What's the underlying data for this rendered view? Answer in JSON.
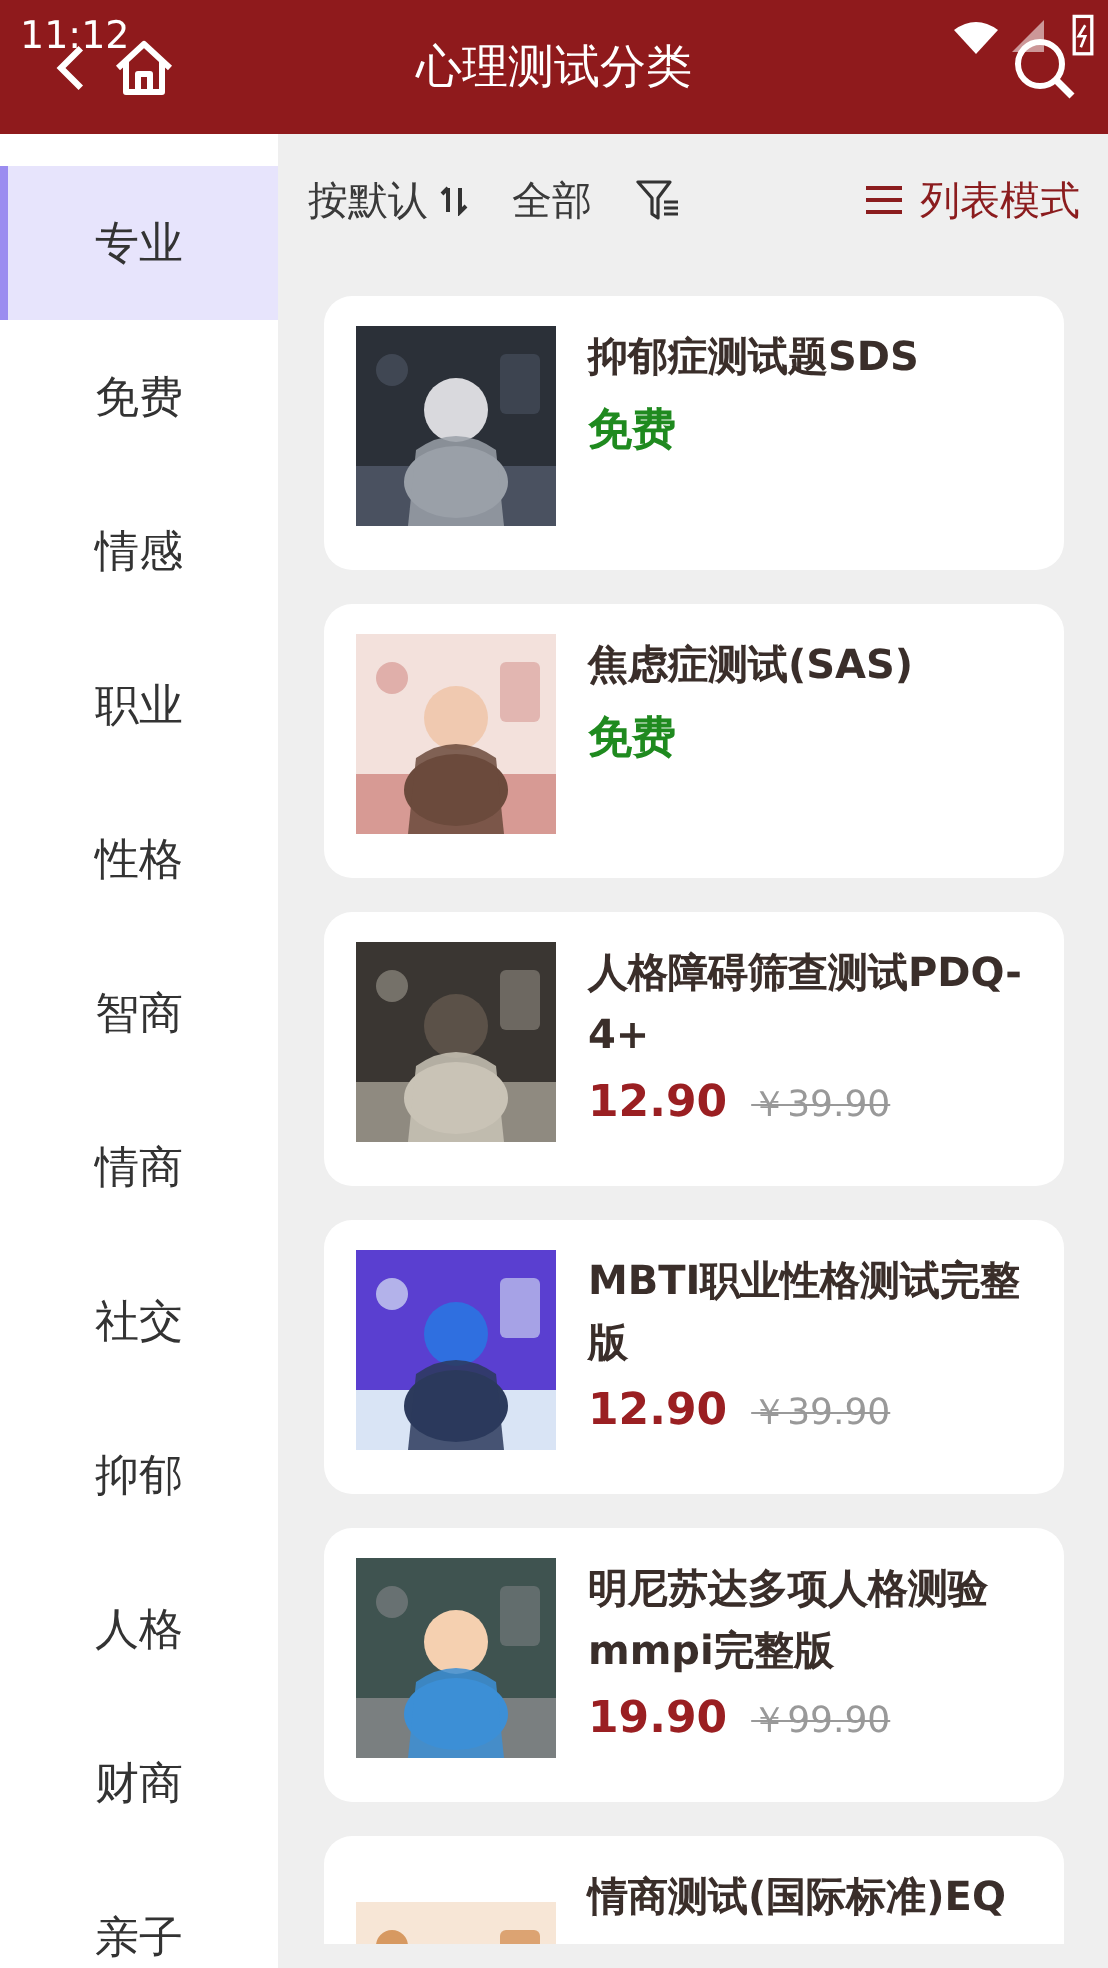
{
  "status_bar": {
    "time": "11:12"
  },
  "header": {
    "title": "心理测试分类"
  },
  "sidebar": {
    "items": [
      {
        "label": "专业",
        "selected": true
      },
      {
        "label": "免费",
        "selected": false
      },
      {
        "label": "情感",
        "selected": false
      },
      {
        "label": "职业",
        "selected": false
      },
      {
        "label": "性格",
        "selected": false
      },
      {
        "label": "智商",
        "selected": false
      },
      {
        "label": "情商",
        "selected": false
      },
      {
        "label": "社交",
        "selected": false
      },
      {
        "label": "抑郁",
        "selected": false
      },
      {
        "label": "人格",
        "selected": false
      },
      {
        "label": "财商",
        "selected": false
      },
      {
        "label": "亲子",
        "selected": false
      }
    ]
  },
  "toolbar": {
    "sort": "按默认",
    "range": "全部",
    "view_mode": "列表模式"
  },
  "tests": [
    {
      "title": "抑郁症测试题SDS",
      "kind": "free",
      "price": "免费"
    },
    {
      "title": "焦虑症测试(SAS)",
      "kind": "free",
      "price": "免费"
    },
    {
      "title": "人格障碍筛查测试PDQ-4+",
      "kind": "paid",
      "price": "12.90",
      "original_price": "￥39.90"
    },
    {
      "title": "MBTI职业性格测试完整版",
      "kind": "paid",
      "price": "12.90",
      "original_price": "￥39.90"
    },
    {
      "title": "明尼苏达多项人格测验mmpi完整版",
      "kind": "paid",
      "price": "19.90",
      "original_price": "￥99.90"
    },
    {
      "title": "情商测试(国际标准)EQ",
      "kind": "partial"
    }
  ]
}
